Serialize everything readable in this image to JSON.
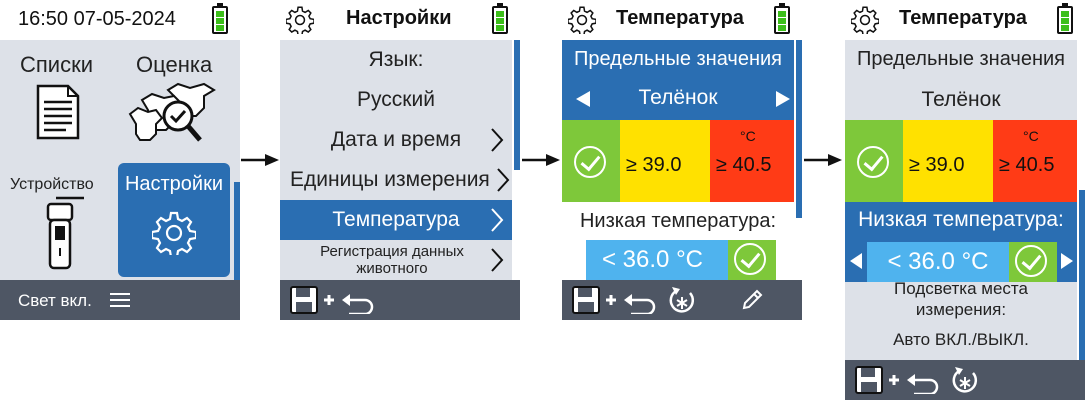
{
  "screen1": {
    "time": "16:50 07-05-2024",
    "tiles": {
      "lists": "Списки",
      "rating": "Оценка",
      "device": "Устройство",
      "settings": "Настройки"
    },
    "footer": {
      "light": "Свет вкл.",
      "menu_icon": "hamburger-menu-icon"
    }
  },
  "screen2": {
    "title": "Настройки",
    "language_label": "Язык:",
    "language_value": "Русский",
    "items": [
      {
        "label": "Дата и время"
      },
      {
        "label": "Единицы измерения"
      },
      {
        "label": "Температура"
      },
      {
        "label": "Регистрация данных животного"
      }
    ]
  },
  "screen3": {
    "title": "Температура",
    "limits_title": "Предельные значения",
    "animal": "Телёнок",
    "zones": {
      "yellow": "≥ 39.0",
      "red": "≥ 40.5",
      "unit": "°C"
    },
    "low_temp_label": "Низкая температура:",
    "low_temp_value": "< 36.0 °C"
  },
  "screen4": {
    "title": "Температура",
    "limits_title": "Предельные значения",
    "animal": "Телёнок",
    "zones": {
      "yellow": "≥ 39.0",
      "red": "≥ 40.5",
      "unit": "°C"
    },
    "low_temp_label": "Низкая температура:",
    "low_temp_value": "< 36.0 °C",
    "backlight_label": "Подсветка места измерения:",
    "backlight_value": "Авто ВКЛ./ВЫКЛ."
  },
  "colors": {
    "accent_blue": "#2a6eb2",
    "light_blue": "#4fb3ee",
    "panel": "#dde1e8",
    "footer": "#4e5664",
    "green": "#7ec83a",
    "yellow": "#ffe100",
    "red": "#ff3b16"
  }
}
